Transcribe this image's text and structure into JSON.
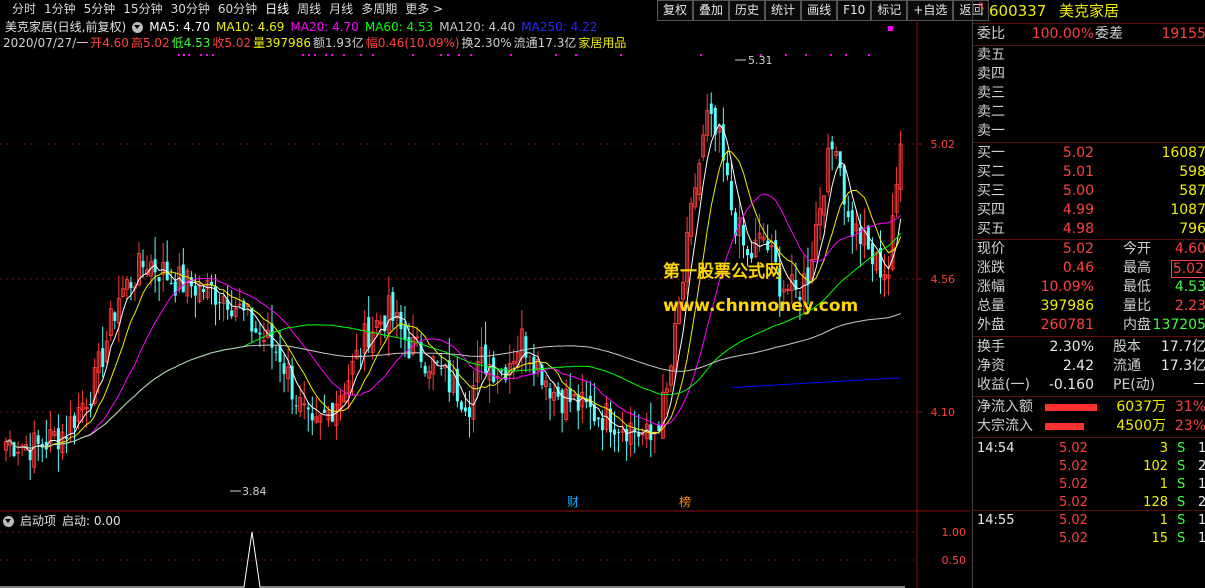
{
  "toolbar": {
    "periods": [
      "分时",
      "1分钟",
      "5分钟",
      "15分钟",
      "30分钟",
      "60分钟",
      "日线",
      "周线",
      "月线",
      "多周期",
      "更多 >"
    ],
    "active_period": "日线",
    "buttons": [
      "复权",
      "叠加",
      "历史",
      "统计",
      "画线",
      "F10",
      "标记",
      "+自选",
      "返回"
    ]
  },
  "title_line": {
    "stock": "美克家居(日线,前复权)",
    "ma5": "MA5: 4.70",
    "ma10": "MA10: 4.69",
    "ma20": "MA20: 4.70",
    "ma60": "MA60: 4.53",
    "ma120": "MA120: 4.40",
    "ma250": "MA250: 4.22"
  },
  "quote_line": {
    "date": "2020/07/27/一",
    "open": "开4.60",
    "high": "高5.02",
    "low": "低4.53",
    "close": "收5.02",
    "volume": "量397986",
    "amount": "额1.93亿",
    "change": "幅0.46(10.09%)",
    "turnover": "换2.30%",
    "float": "流通17.3亿",
    "sector": "家居用品"
  },
  "chart": {
    "y_labels": [
      "5.02",
      "4.56",
      "4.10"
    ],
    "max_label": "5.31",
    "min_label": "3.84",
    "markers": [
      "财",
      "榜"
    ],
    "colors": {
      "up": "#ff3c3c",
      "down": "#54ffff",
      "ma5": "#ffffff",
      "ma10": "#f0f000",
      "ma20": "#ff00ff",
      "ma60": "#00ff00",
      "ma120": "#c8c8c8",
      "ma250": "#0000ff"
    },
    "watermark": [
      "第一股票公式网",
      "www.chnmoney.com"
    ]
  },
  "sub_panel": {
    "name": "启动项",
    "value": "启动: 0.00",
    "y_labels": [
      "1.00",
      "0.50"
    ]
  },
  "quote_panel": {
    "code": "600337",
    "name": "美克家居",
    "weibi_label": "委比",
    "weibi": "100.00%",
    "weicha_label": "委差",
    "weicha": "19155",
    "asks": [
      {
        "label": "卖五",
        "price": "",
        "vol": ""
      },
      {
        "label": "卖四",
        "price": "",
        "vol": ""
      },
      {
        "label": "卖三",
        "price": "",
        "vol": ""
      },
      {
        "label": "卖二",
        "price": "",
        "vol": ""
      },
      {
        "label": "卖一",
        "price": "",
        "vol": ""
      }
    ],
    "bids": [
      {
        "label": "买一",
        "price": "5.02",
        "vol": "16087"
      },
      {
        "label": "买二",
        "price": "5.01",
        "vol": "598"
      },
      {
        "label": "买三",
        "price": "5.00",
        "vol": "587"
      },
      {
        "label": "买四",
        "price": "4.99",
        "vol": "1087"
      },
      {
        "label": "买五",
        "price": "4.98",
        "vol": "796"
      }
    ],
    "stats": [
      {
        "l1": "现价",
        "v1": "5.02",
        "l2": "今开",
        "v2": "4.60"
      },
      {
        "l1": "涨跌",
        "v1": "0.46",
        "l2": "最高",
        "v2": "5.02"
      },
      {
        "l1": "涨幅",
        "v1": "10.09%",
        "l2": "最低",
        "v2": "4.53"
      },
      {
        "l1": "总量",
        "v1": "397986",
        "l2": "量比",
        "v2": "2.23"
      },
      {
        "l1": "外盘",
        "v1": "260781",
        "l2": "内盘",
        "v2": "137205"
      }
    ],
    "stats2": [
      {
        "l1": "换手",
        "v1": "2.30%",
        "l2": "股本",
        "v2": "17.7亿"
      },
      {
        "l1": "净资",
        "v1": "2.42",
        "l2": "流通",
        "v2": "17.3亿"
      },
      {
        "l1": "收益(一)",
        "v1": "-0.160",
        "l2": "PE(动)",
        "v2": "－"
      }
    ],
    "flows": [
      {
        "label": "净流入额",
        "amount": "6037万",
        "pct": "31%",
        "fill": 0.31
      },
      {
        "label": "大宗流入",
        "amount": "4500万",
        "pct": "23%",
        "fill": 0.23
      }
    ],
    "ticks": [
      {
        "time": "14:54",
        "price": "5.02",
        "vol": "3",
        "side": "S",
        "n": "1"
      },
      {
        "time": "",
        "price": "5.02",
        "vol": "102",
        "side": "S",
        "n": "2"
      },
      {
        "time": "",
        "price": "5.02",
        "vol": "1",
        "side": "S",
        "n": "1"
      },
      {
        "time": "",
        "price": "5.02",
        "vol": "128",
        "side": "S",
        "n": "2"
      },
      {
        "time": "14:55",
        "price": "5.02",
        "vol": "1",
        "side": "S",
        "n": "1"
      },
      {
        "time": "",
        "price": "5.02",
        "vol": "15",
        "side": "S",
        "n": "1"
      }
    ]
  }
}
